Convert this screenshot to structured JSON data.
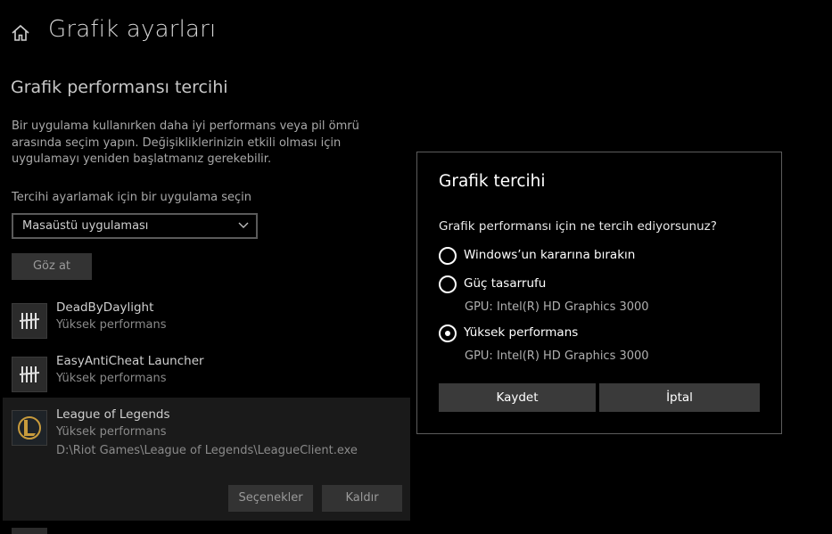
{
  "header": {
    "title": "Grafik ayarları",
    "home_icon": "home-icon"
  },
  "section": {
    "title": "Grafik performansı tercihi",
    "description": "Bir uygulama kullanırken daha iyi performans veya pil ömrü arasında seçim yapın. Değişikliklerinizin etkili olması için uygulamayı yeniden başlatmanız gerekebilir.",
    "select_label": "Tercihi ayarlamak için bir uygulama seçin",
    "select_value": "Masaüstü uygulaması",
    "browse_label": "Göz at"
  },
  "apps": [
    {
      "name": "DeadByDaylight",
      "preference": "Yüksek performans",
      "icon": "dbd-icon"
    },
    {
      "name": "EasyAntiCheat Launcher",
      "preference": "Yüksek performans",
      "icon": "dbd-icon"
    },
    {
      "name": "League of Legends",
      "preference": "Yüksek performans",
      "path": "D:\\Riot Games\\League of Legends\\LeagueClient.exe",
      "icon": "league-icon"
    }
  ],
  "selected_actions": {
    "options_label": "Seçenekler",
    "remove_label": "Kaldır"
  },
  "dialog": {
    "title": "Grafik tercihi",
    "question": "Grafik performansı için ne tercih ediyorsunuz?",
    "options": [
      {
        "label": "Windows’un kararına bırakın",
        "checked": false
      },
      {
        "label": "Güç tasarrufu",
        "gpu": "GPU: Intel(R) HD Graphics 3000",
        "checked": false
      },
      {
        "label": "Yüksek performans",
        "gpu": "GPU: Intel(R) HD Graphics 3000",
        "checked": true
      }
    ],
    "save_label": "Kaydet",
    "cancel_label": "İptal"
  },
  "colors": {
    "background": "#000000",
    "selected_panel": "#1a1a1a",
    "button": "#3a3a3a",
    "league_gold": "#c89b3c"
  }
}
